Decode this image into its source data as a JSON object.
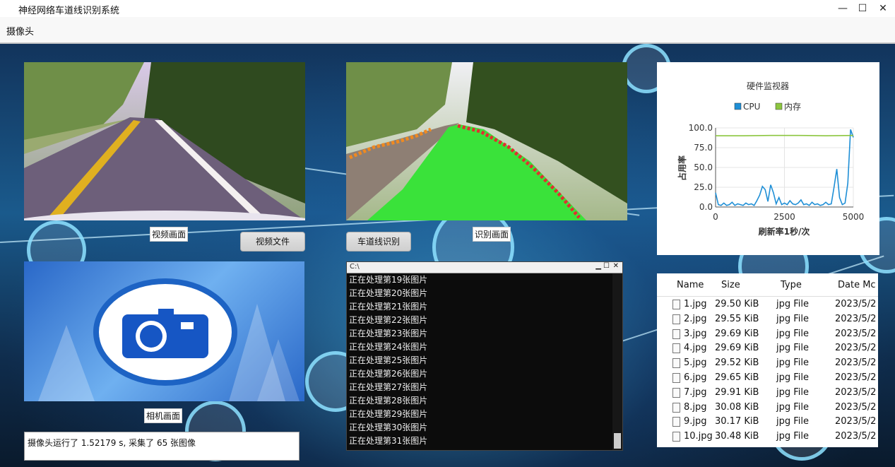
{
  "window": {
    "title": "神经网络车道线识别系统",
    "menu": "摄像头",
    "minimize_glyph": "—",
    "maximize_glyph": "☐",
    "close_glyph": "✕"
  },
  "captions": {
    "video": "视频画面",
    "detect": "识别画面",
    "camera": "相机画面"
  },
  "buttons": {
    "video_file": "视频文件",
    "lane_detect": "车道线识别"
  },
  "console": {
    "title": "C:\\",
    "lines": [
      "正在处理第19张图片",
      "正在处理第20张图片",
      "正在处理第21张图片",
      "正在处理第22张图片",
      "正在处理第23张图片",
      "正在处理第24张图片",
      "正在处理第25张图片",
      "正在处理第26张图片",
      "正在处理第27张图片",
      "正在处理第28张图片",
      "正在处理第29张图片",
      "正在处理第30张图片",
      "正在处理第31张图片"
    ]
  },
  "status": "摄像头运行了 1.52179 s, 采集了 65 张图像",
  "chart_data": {
    "type": "line",
    "title": "硬件监视器",
    "xlabel": "刷新率1秒/次",
    "ylabel": "占用率",
    "xlim": [
      0,
      5000
    ],
    "ylim": [
      0,
      100
    ],
    "xticks": [
      "0",
      "2500",
      "5000"
    ],
    "yticks": [
      "0.0",
      "25.0",
      "50.0",
      "75.0",
      "100.0"
    ],
    "legend_position": "top",
    "grid": true,
    "series": [
      {
        "name": "CPU",
        "color": "#1f8fd6",
        "x": [
          0,
          100,
          200,
          300,
          400,
          500,
          600,
          700,
          800,
          900,
          1000,
          1100,
          1200,
          1300,
          1400,
          1500,
          1600,
          1700,
          1800,
          1900,
          2000,
          2100,
          2200,
          2300,
          2400,
          2500,
          2600,
          2700,
          2800,
          2900,
          3000,
          3100,
          3200,
          3300,
          3400,
          3500,
          3600,
          3700,
          3800,
          3900,
          4000,
          4100,
          4200,
          4300,
          4400,
          4500,
          4600,
          4700,
          4800,
          4900,
          5000
        ],
        "values": [
          18,
          3,
          2,
          5,
          2,
          3,
          6,
          2,
          4,
          3,
          2,
          5,
          3,
          4,
          2,
          8,
          15,
          26,
          22,
          7,
          28,
          18,
          4,
          12,
          3,
          5,
          3,
          8,
          4,
          3,
          5,
          9,
          3,
          4,
          2,
          6,
          3,
          4,
          2,
          3,
          6,
          3,
          4,
          25,
          48,
          12,
          3,
          5,
          30,
          98,
          88
        ]
      },
      {
        "name": "内存",
        "color": "#8cc63f",
        "x": [
          0,
          1000,
          2000,
          3000,
          4000,
          5000
        ],
        "values": [
          90,
          90,
          90.5,
          90.5,
          90,
          90.5
        ]
      }
    ]
  },
  "file_list": {
    "columns": [
      "Name",
      "Size",
      "Type",
      "Date Mc"
    ],
    "rows": [
      {
        "name": "1.jpg",
        "size": "29.50 KiB",
        "type": "jpg File",
        "date": "2023/5/2"
      },
      {
        "name": "2.jpg",
        "size": "29.55 KiB",
        "type": "jpg File",
        "date": "2023/5/2"
      },
      {
        "name": "3.jpg",
        "size": "29.69 KiB",
        "type": "jpg File",
        "date": "2023/5/2"
      },
      {
        "name": "4.jpg",
        "size": "29.69 KiB",
        "type": "jpg File",
        "date": "2023/5/2"
      },
      {
        "name": "5.jpg",
        "size": "29.52 KiB",
        "type": "jpg File",
        "date": "2023/5/2"
      },
      {
        "name": "6.jpg",
        "size": "29.65 KiB",
        "type": "jpg File",
        "date": "2023/5/2"
      },
      {
        "name": "7.jpg",
        "size": "29.91 KiB",
        "type": "jpg File",
        "date": "2023/5/2"
      },
      {
        "name": "8.jpg",
        "size": "30.08 KiB",
        "type": "jpg File",
        "date": "2023/5/2"
      },
      {
        "name": "9.jpg",
        "size": "30.17 KiB",
        "type": "jpg File",
        "date": "2023/5/2"
      },
      {
        "name": "10.jpg",
        "size": "30.48 KiB",
        "type": "jpg File",
        "date": "2023/5/2"
      }
    ]
  }
}
